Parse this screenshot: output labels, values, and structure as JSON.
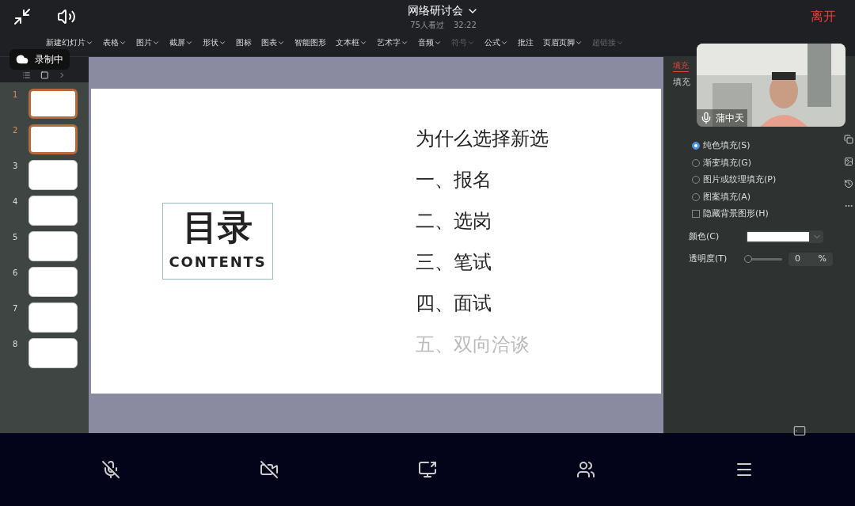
{
  "top_bar": {
    "title": "网络研讨会",
    "viewers": "75人看过",
    "duration": "32:22",
    "leave": "离开"
  },
  "recording": "录制中",
  "toolbar": [
    {
      "label": "新建幻灯片",
      "dropdown": true,
      "disabled": false
    },
    {
      "label": "表格",
      "dropdown": true,
      "disabled": false
    },
    {
      "label": "图片",
      "dropdown": true,
      "disabled": false
    },
    {
      "label": "截屏",
      "dropdown": true,
      "disabled": false
    },
    {
      "label": "形状",
      "dropdown": true,
      "disabled": false
    },
    {
      "label": "图标",
      "dropdown": false,
      "disabled": false
    },
    {
      "label": "图表",
      "dropdown": true,
      "disabled": false
    },
    {
      "label": "智能图形",
      "dropdown": false,
      "disabled": false
    },
    {
      "label": "文本框",
      "dropdown": true,
      "disabled": false
    },
    {
      "label": "艺术字",
      "dropdown": true,
      "disabled": false
    },
    {
      "label": "音频",
      "dropdown": true,
      "disabled": false
    },
    {
      "label": "符号",
      "dropdown": true,
      "disabled": true
    },
    {
      "label": "公式",
      "dropdown": true,
      "disabled": false
    },
    {
      "label": "批注",
      "dropdown": false,
      "disabled": false
    },
    {
      "label": "页眉页脚",
      "dropdown": true,
      "disabled": false
    },
    {
      "label": "超链接",
      "dropdown": true,
      "disabled": true
    }
  ],
  "slides": [
    {
      "number": "1",
      "selected": true
    },
    {
      "number": "2",
      "selected": true
    },
    {
      "number": "3",
      "selected": false
    },
    {
      "number": "4",
      "selected": false
    },
    {
      "number": "5",
      "selected": false
    },
    {
      "number": "6",
      "selected": false
    },
    {
      "number": "7",
      "selected": false
    },
    {
      "number": "8",
      "selected": false
    }
  ],
  "slide": {
    "title": "目录",
    "subtitle": "CONTENTS",
    "items": [
      {
        "text": "为什么选择新选",
        "faded": false
      },
      {
        "text": "一、报名",
        "faded": false
      },
      {
        "text": "二、选岗",
        "faded": false
      },
      {
        "text": "三、笔试",
        "faded": false
      },
      {
        "text": "四、面试",
        "faded": false
      },
      {
        "text": "五、双向洽谈",
        "faded": true
      }
    ]
  },
  "properties": {
    "tab": "填充",
    "section": "填充",
    "fill_options": [
      {
        "label": "纯色填充(S)",
        "selected": true
      },
      {
        "label": "渐变填充(G)",
        "selected": false
      },
      {
        "label": "图片或纹理填充(P)",
        "selected": false
      },
      {
        "label": "图案填充(A)",
        "selected": false
      }
    ],
    "hide_background": {
      "label": "隐藏背景图形(H)",
      "checked": false
    },
    "color_label": "颜色(C)",
    "color": "#ffffff",
    "transparency": {
      "label": "透明度(T)",
      "level": 0,
      "value": "0",
      "unit": "%"
    }
  },
  "video": {
    "name": "蒲中天"
  }
}
